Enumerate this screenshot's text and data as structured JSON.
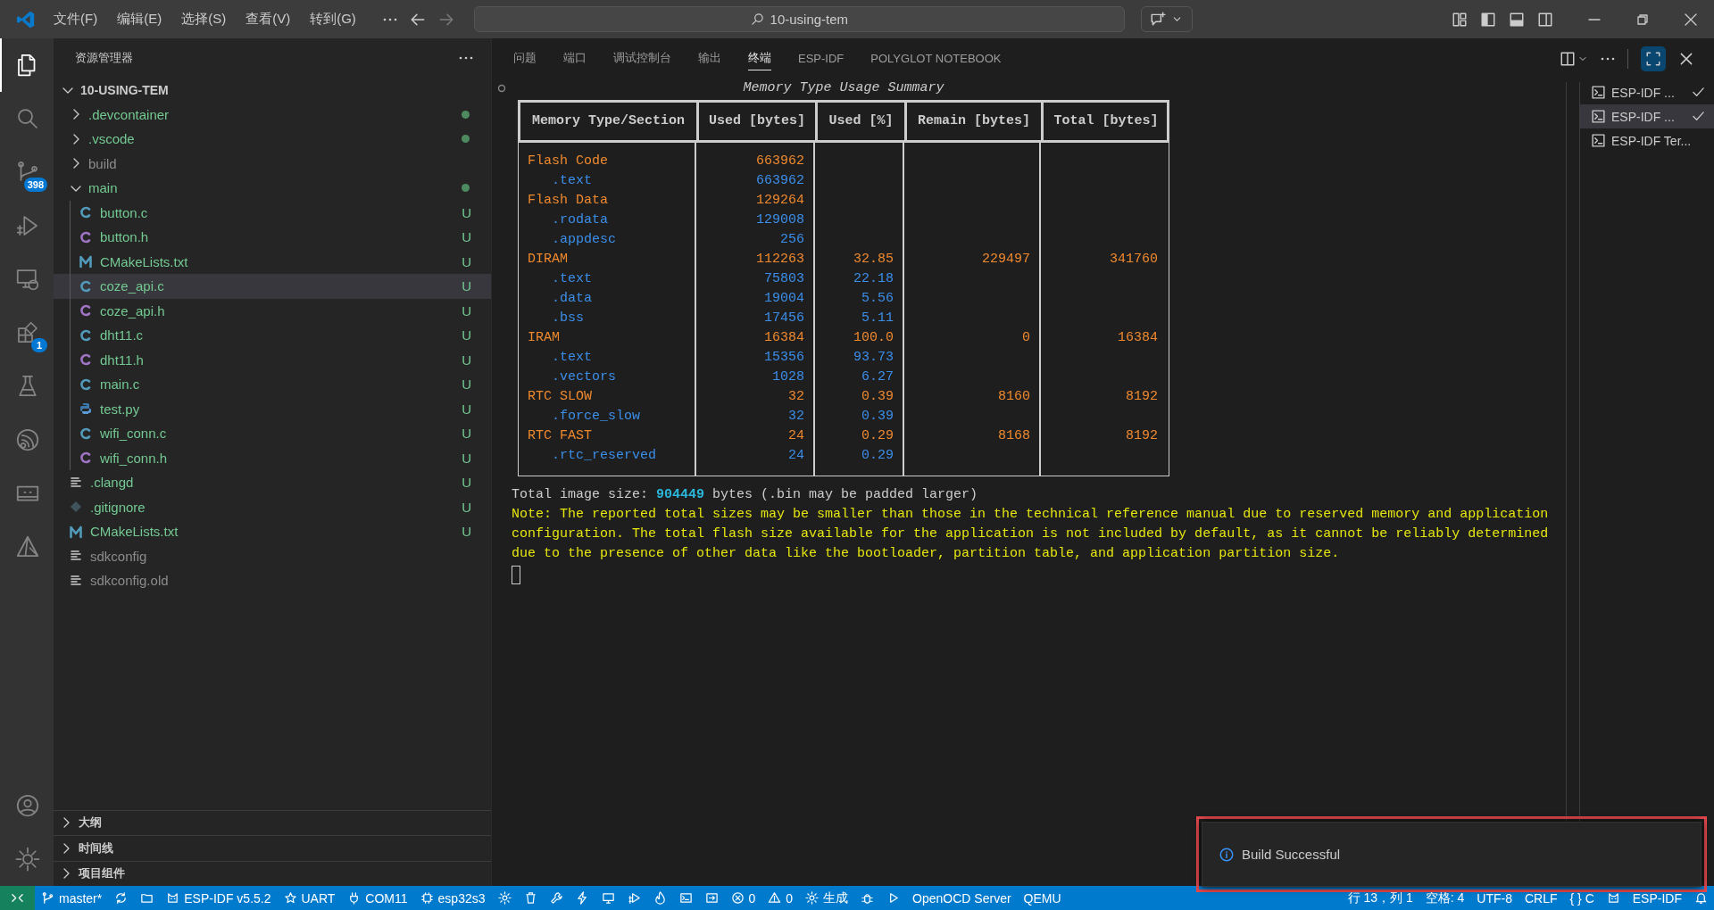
{
  "title_bar": {
    "menus": [
      "文件(F)",
      "编辑(E)",
      "选择(S)",
      "查看(V)",
      "转到(G)"
    ],
    "search": "10-using-tem"
  },
  "activity_bar": {
    "items": [
      {
        "kind": "files",
        "selected": true
      },
      {
        "kind": "search",
        "selected": false
      },
      {
        "kind": "source-control",
        "selected": false,
        "badge": "398"
      },
      {
        "kind": "run-debug",
        "selected": false
      },
      {
        "kind": "remote",
        "selected": false
      },
      {
        "kind": "extensions",
        "selected": false,
        "badge": "1"
      },
      {
        "kind": "flask",
        "selected": false
      },
      {
        "kind": "espressif",
        "selected": false
      },
      {
        "kind": "device",
        "selected": false
      },
      {
        "kind": "prism",
        "selected": false
      }
    ],
    "bottom": [
      {
        "kind": "account"
      },
      {
        "kind": "settings"
      }
    ]
  },
  "sidebar": {
    "title": "资源管理器",
    "root": {
      "label": "10-USING-TEM",
      "expanded": true,
      "children": [
        {
          "label": ".devcontainer",
          "kind": "folder",
          "expanded": false,
          "ignored": false,
          "dot": true,
          "selected": false
        },
        {
          "label": ".vscode",
          "kind": "folder",
          "expanded": false,
          "ignored": false,
          "dot": true,
          "selected": false
        },
        {
          "label": "build",
          "kind": "folder",
          "expanded": false,
          "ignored": true,
          "dot": false,
          "selected": false
        },
        {
          "label": "main",
          "kind": "folder",
          "expanded": true,
          "ignored": false,
          "dot": true,
          "selected": false,
          "children": [
            {
              "label": "button.c",
              "kind": "c",
              "ignored": false,
              "decoration": "U",
              "selected": false
            },
            {
              "label": "button.h",
              "kind": "h",
              "ignored": false,
              "decoration": "U",
              "selected": false
            },
            {
              "label": "CMakeLists.txt",
              "kind": "cmake",
              "ignored": false,
              "decoration": "U",
              "selected": false
            },
            {
              "label": "coze_api.c",
              "kind": "c",
              "ignored": false,
              "decoration": "U",
              "selected": true
            },
            {
              "label": "coze_api.h",
              "kind": "h",
              "ignored": false,
              "decoration": "U",
              "selected": false
            },
            {
              "label": "dht11.c",
              "kind": "c",
              "ignored": false,
              "decoration": "U",
              "selected": false
            },
            {
              "label": "dht11.h",
              "kind": "h",
              "ignored": false,
              "decoration": "U",
              "selected": false
            },
            {
              "label": "main.c",
              "kind": "c",
              "ignored": false,
              "decoration": "U",
              "selected": false
            },
            {
              "label": "test.py",
              "kind": "py",
              "ignored": false,
              "decoration": "U",
              "selected": false
            },
            {
              "label": "wifi_conn.c",
              "kind": "c",
              "ignored": false,
              "decoration": "U",
              "selected": false
            },
            {
              "label": "wifi_conn.h",
              "kind": "h",
              "ignored": false,
              "decoration": "U",
              "selected": false
            }
          ]
        },
        {
          "label": ".clangd",
          "kind": "text",
          "ignored": false,
          "decoration": "U",
          "selected": false
        },
        {
          "label": ".gitignore",
          "kind": "git",
          "ignored": false,
          "decoration": "U",
          "selected": false
        },
        {
          "label": "CMakeLists.txt",
          "kind": "cmake",
          "ignored": false,
          "decoration": "U",
          "selected": false
        },
        {
          "label": "sdkconfig",
          "kind": "text",
          "ignored": true,
          "selected": false
        },
        {
          "label": "sdkconfig.old",
          "kind": "text",
          "ignored": true,
          "selected": false
        }
      ]
    },
    "sections": [
      {
        "label": "大纲",
        "expanded": false
      },
      {
        "label": "时间线",
        "expanded": false
      },
      {
        "label": "项目组件",
        "expanded": false
      }
    ]
  },
  "panel": {
    "tabs": [
      {
        "label": "问题",
        "selected": false
      },
      {
        "label": "端口",
        "selected": false
      },
      {
        "label": "调试控制台",
        "selected": false
      },
      {
        "label": "输出",
        "selected": false
      },
      {
        "label": "终端",
        "selected": true
      },
      {
        "label": "ESP-IDF",
        "selected": false
      },
      {
        "label": "POLYGLOT NOTEBOOK",
        "selected": false
      }
    ],
    "terminal": {
      "title": "Memory Type Usage Summary",
      "columns": [
        "Memory Type/Section",
        "Used [bytes]",
        "Used [%]",
        "Remain [bytes]",
        "Total [bytes]"
      ],
      "rows": [
        {
          "kind": "memory",
          "name": "Flash Code",
          "used": "663962"
        },
        {
          "kind": "section",
          "name": ".text",
          "used": "663962"
        },
        {
          "kind": "memory",
          "name": "Flash Data",
          "used": "129264"
        },
        {
          "kind": "section",
          "name": ".rodata",
          "used": "129008"
        },
        {
          "kind": "section",
          "name": ".appdesc",
          "used": "256"
        },
        {
          "kind": "memory",
          "name": "DIRAM",
          "used": "112263",
          "percent": "32.85",
          "remain": "229497",
          "total": "341760"
        },
        {
          "kind": "section",
          "name": ".text",
          "used": "75803",
          "percent": "22.18"
        },
        {
          "kind": "section",
          "name": ".data",
          "used": "19004",
          "percent": "5.56"
        },
        {
          "kind": "section",
          "name": ".bss",
          "used": "17456",
          "percent": "5.11"
        },
        {
          "kind": "memory",
          "name": "IRAM",
          "used": "16384",
          "percent": "100.0",
          "remain": "0",
          "total": "16384"
        },
        {
          "kind": "section",
          "name": ".text",
          "used": "15356",
          "percent": "93.73"
        },
        {
          "kind": "section",
          "name": ".vectors",
          "used": "1028",
          "percent": "6.27"
        },
        {
          "kind": "memory",
          "name": "RTC SLOW",
          "used": "32",
          "percent": "0.39",
          "remain": "8160",
          "total": "8192"
        },
        {
          "kind": "section",
          "name": ".force_slow",
          "used": "32",
          "percent": "0.39"
        },
        {
          "kind": "memory",
          "name": "RTC FAST",
          "used": "24",
          "percent": "0.29",
          "remain": "8168",
          "total": "8192"
        },
        {
          "kind": "section",
          "name": ".rtc_reserved",
          "used": "24",
          "percent": "0.29"
        }
      ],
      "total_line": "Total image size: **904449** bytes (.bin may be padded larger)",
      "note": "Note: The reported total sizes may be smaller than those in the technical reference manual due to reserved memory and application configuration. The total flash size available for the application is not included by default, as it cannot be reliably determined due to the presence of other data like the bootloader, partition table, and application partition size."
    },
    "terminals": [
      {
        "label": "ESP-IDF ...",
        "checked": true,
        "selected": false
      },
      {
        "label": "ESP-IDF ...",
        "checked": true,
        "selected": true
      },
      {
        "label": "ESP-IDF Ter...",
        "checked": false,
        "selected": false
      }
    ]
  },
  "notification": {
    "message": "Build Successful"
  },
  "status_bar": {
    "left": [
      {
        "kind": "remote"
      },
      {
        "kind": "branch",
        "text": "master*"
      },
      {
        "kind": "sync"
      },
      {
        "kind": "folder"
      },
      {
        "kind": "cat",
        "text": "ESP-IDF v5.5.2"
      },
      {
        "kind": "star",
        "text": "UART"
      },
      {
        "kind": "plug",
        "text": "COM11"
      },
      {
        "kind": "chip",
        "text": "esp32s3"
      },
      {
        "kind": "gear"
      },
      {
        "kind": "trash"
      },
      {
        "kind": "wrench"
      },
      {
        "kind": "bolt"
      },
      {
        "kind": "monitor"
      },
      {
        "kind": "debug-play"
      },
      {
        "kind": "flame"
      },
      {
        "kind": "terminal"
      },
      {
        "kind": "arrow-box"
      },
      {
        "kind": "error",
        "text": "0"
      },
      {
        "kind": "warning",
        "text": "0"
      },
      {
        "kind": "gear",
        "text": "生成"
      },
      {
        "kind": "bug"
      },
      {
        "kind": "play"
      },
      {
        "kind": "text",
        "text": "OpenOCD Server"
      },
      {
        "kind": "text",
        "text": "QEMU"
      }
    ],
    "right": [
      {
        "kind": "text",
        "text": "行 13，列 1"
      },
      {
        "kind": "text",
        "text": "空格: 4"
      },
      {
        "kind": "text",
        "text": "UTF-8"
      },
      {
        "kind": "text",
        "text": "CRLF"
      },
      {
        "kind": "text",
        "text": "{ } C"
      },
      {
        "kind": "cat"
      },
      {
        "kind": "text",
        "text": "ESP-IDF"
      },
      {
        "kind": "bell"
      }
    ]
  }
}
